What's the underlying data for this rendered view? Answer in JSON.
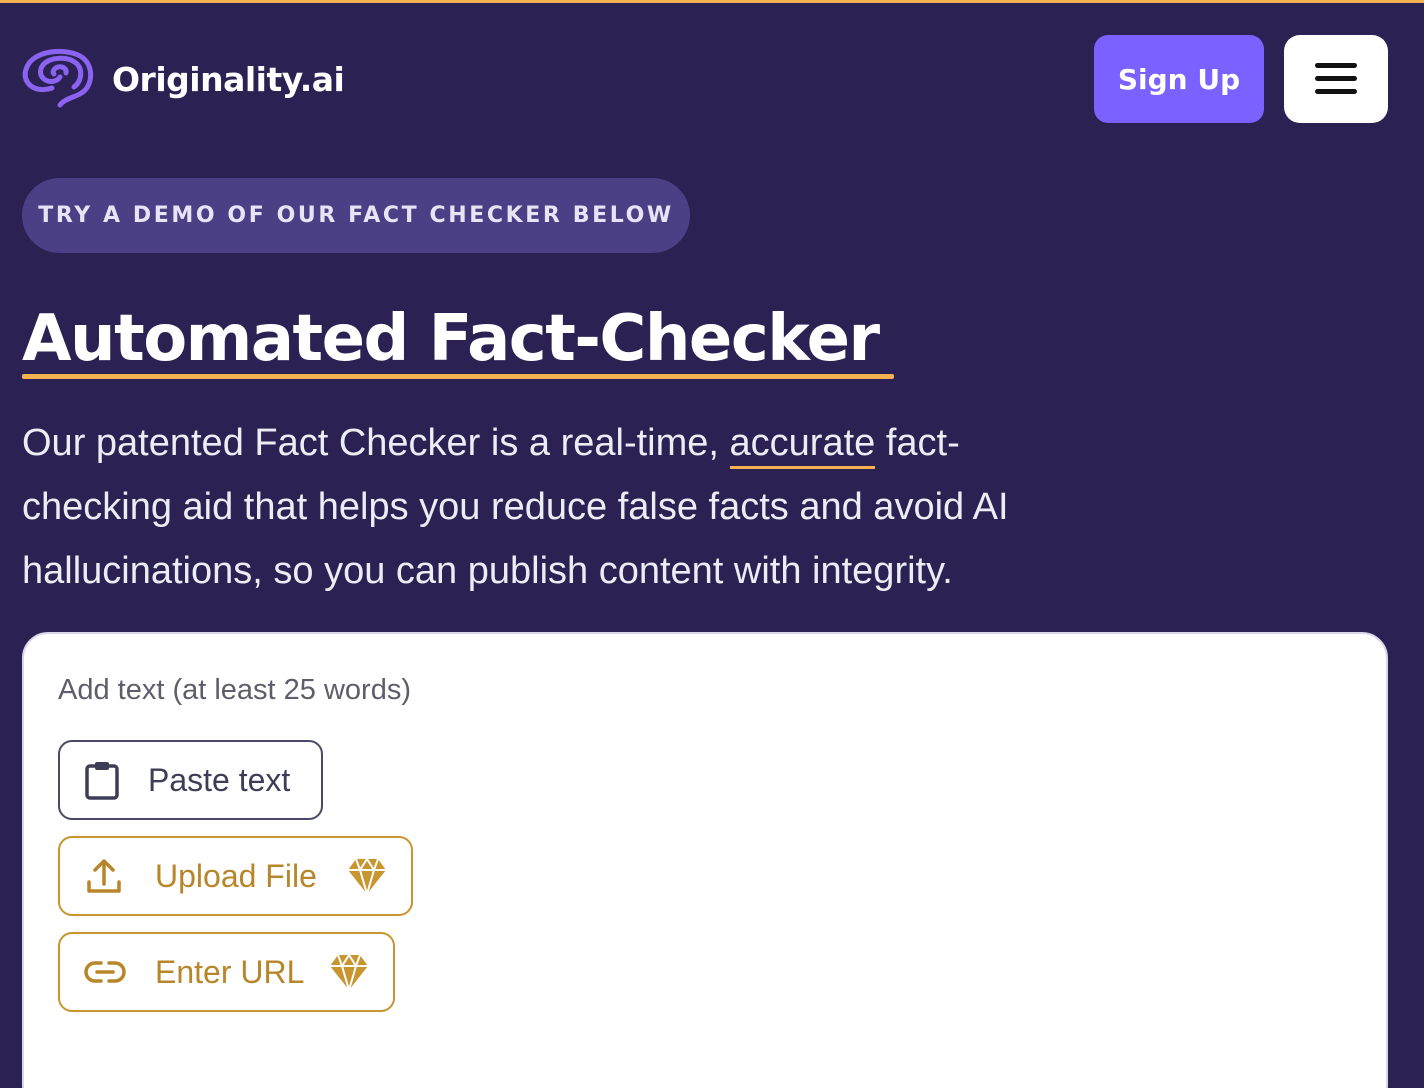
{
  "brand": {
    "name": "Originality.ai",
    "logo_icon": "brain-icon",
    "accent_color": "#7b61ff",
    "highlight_color": "#f7b24f",
    "background_color": "#2b2253"
  },
  "header": {
    "signup_label": "Sign Up",
    "menu_icon": "hamburger-menu-icon"
  },
  "hero": {
    "badge": "TRY A DEMO OF OUR FACT CHECKER BELOW",
    "title": "Automated Fact-Checker",
    "desc_before": "Our patented Fact Checker is a real-time, ",
    "desc_link": "accurate",
    "desc_after": " fact-checking aid that helps you reduce false facts and avoid AI hallucinations, so you can publish content with integrity."
  },
  "checker": {
    "input_label": "Add text (at least 25 words)",
    "paste_label": "Paste text",
    "upload_label": "Upload File",
    "url_label": "Enter URL",
    "premium_icon": "diamond-icon"
  }
}
